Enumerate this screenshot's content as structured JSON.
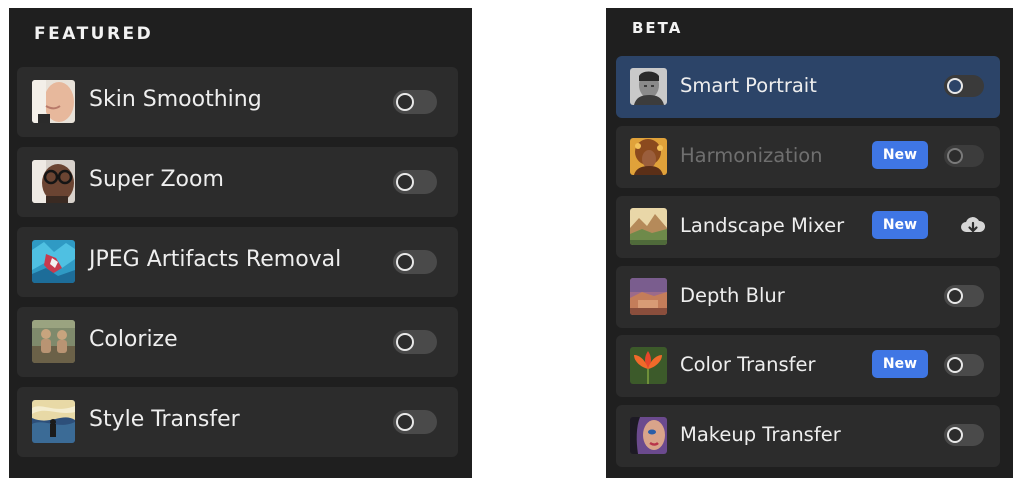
{
  "featured": {
    "title": "FEATURED",
    "items": [
      {
        "label": "Skin Smoothing",
        "thumb": "skin-smoothing-thumbnail",
        "toggle": "off"
      },
      {
        "label": "Super Zoom",
        "thumb": "super-zoom-thumbnail",
        "toggle": "off"
      },
      {
        "label": "JPEG Artifacts Removal",
        "thumb": "jpeg-artifacts-thumbnail",
        "toggle": "off"
      },
      {
        "label": "Colorize",
        "thumb": "colorize-thumbnail",
        "toggle": "off"
      },
      {
        "label": "Style Transfer",
        "thumb": "style-transfer-thumbnail",
        "toggle": "off"
      }
    ]
  },
  "beta": {
    "title": "BETA",
    "items": [
      {
        "label": "Smart Portrait",
        "selected": true,
        "badge": "",
        "control": "toggle-off"
      },
      {
        "label": "Harmonization",
        "disabled": true,
        "badge": "New",
        "control": "toggle-off"
      },
      {
        "label": "Landscape Mixer",
        "badge": "New",
        "control": "cloud-download-icon"
      },
      {
        "label": "Depth Blur",
        "badge": "",
        "control": "toggle-off"
      },
      {
        "label": "Color Transfer",
        "badge": "New",
        "control": "toggle-off"
      },
      {
        "label": "Makeup Transfer",
        "badge": "",
        "control": "toggle-off"
      }
    ]
  },
  "colors": {
    "panel_background": "#1f1f1f",
    "item_background": "#2c2c2c",
    "selected_item_background": "#2c4468",
    "badge_background": "#3f76e4"
  }
}
